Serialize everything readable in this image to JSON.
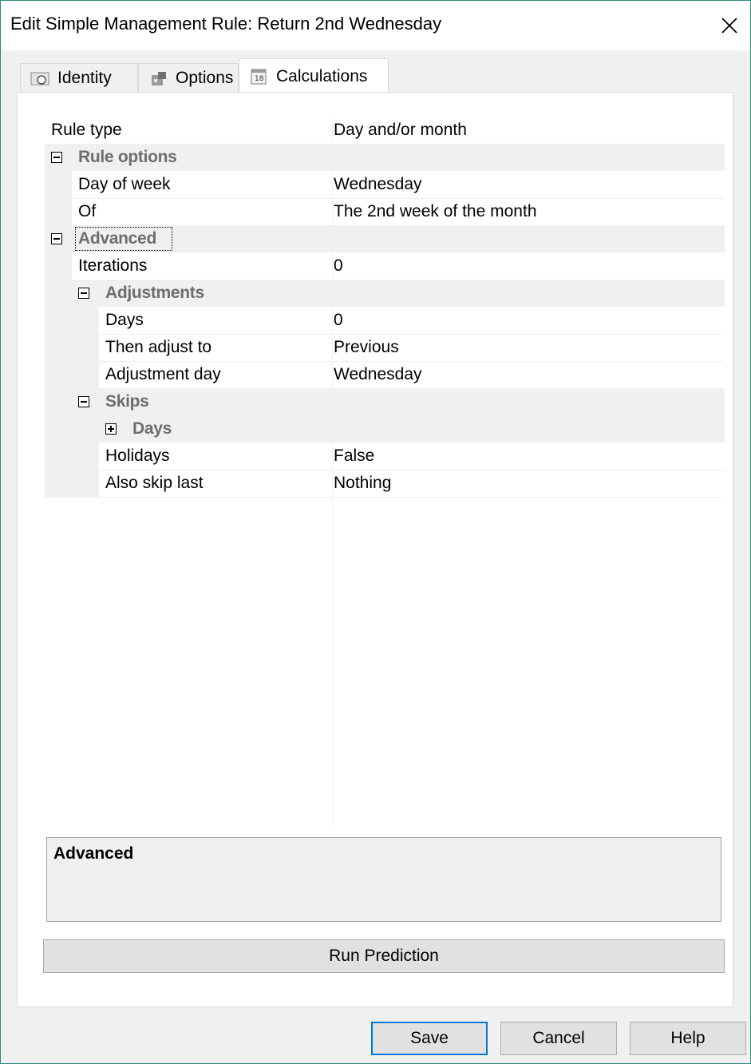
{
  "window": {
    "title": "Edit Simple Management Rule: Return 2nd Wednesday"
  },
  "tabs": [
    {
      "label": "Identity",
      "icon": "identity-icon"
    },
    {
      "label": "Options",
      "icon": "options-icon"
    },
    {
      "label": "Calculations",
      "icon": "calendar-icon"
    }
  ],
  "active_tab": "Calculations",
  "grid": {
    "rule_type": {
      "name": "Rule type",
      "value": "Day and/or month"
    },
    "rule_options": {
      "label": "Rule options",
      "day_of_week": {
        "name": "Day of week",
        "value": "Wednesday"
      },
      "of": {
        "name": "Of",
        "value": "The 2nd week of the month"
      }
    },
    "advanced": {
      "label": "Advanced",
      "iterations": {
        "name": "Iterations",
        "value": "0"
      },
      "adjustments": {
        "label": "Adjustments",
        "days": {
          "name": "Days",
          "value": "0"
        },
        "then_adjust_to": {
          "name": "Then adjust to",
          "value": "Previous"
        },
        "adjustment_day": {
          "name": "Adjustment day",
          "value": "Wednesday"
        }
      },
      "skips": {
        "label": "Skips",
        "days_label": "Days",
        "holidays": {
          "name": "Holidays",
          "value": "False"
        },
        "also_skip_last": {
          "name": "Also skip last",
          "value": "Nothing"
        }
      }
    }
  },
  "description": {
    "title": "Advanced"
  },
  "buttons": {
    "run_prediction": "Run Prediction",
    "save": "Save",
    "cancel": "Cancel",
    "help": "Help"
  }
}
